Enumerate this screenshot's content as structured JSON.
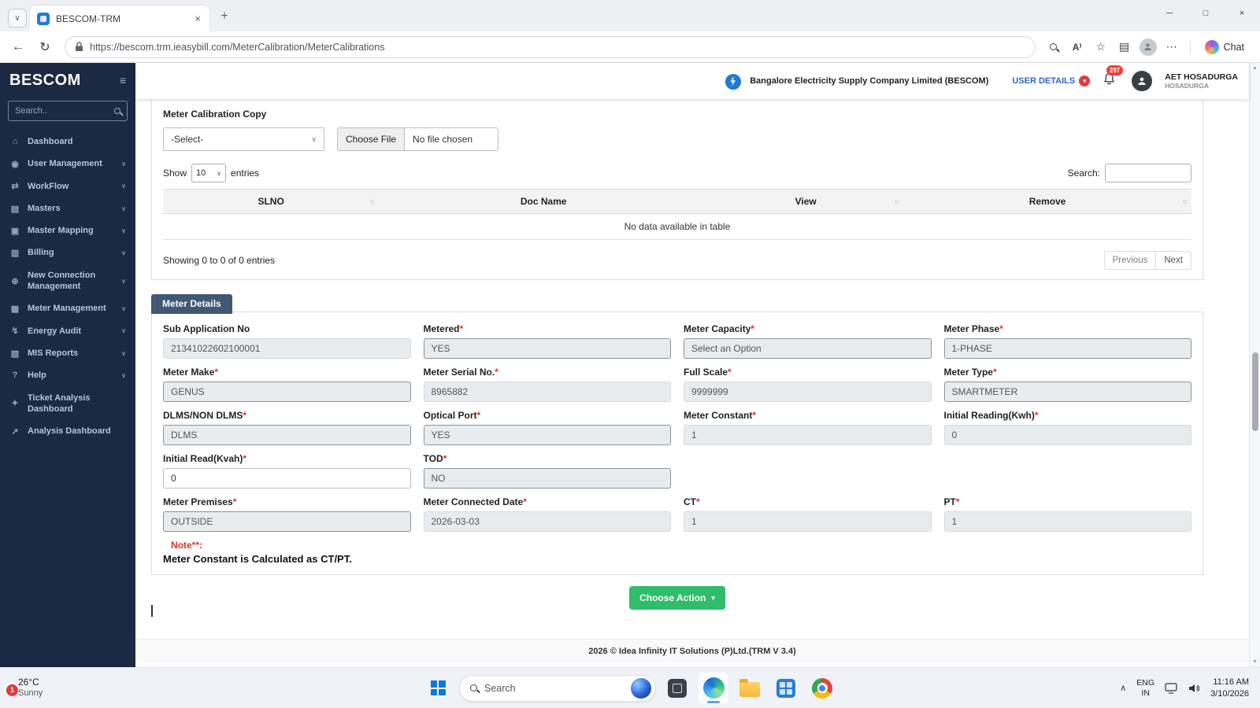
{
  "browser": {
    "tab_title": "BESCOM-TRM",
    "url": "https://bescom.trm.ieasybill.com/MeterCalibration/MeterCalibrations",
    "chat_label": "Chat"
  },
  "icons": {
    "chevron_down": "∨",
    "chevron_up": "∧",
    "caret_down": "▾",
    "hamburger": "≡",
    "back": "←",
    "refresh": "↻",
    "new_tab": "+",
    "close": "×",
    "minimize": "─",
    "maximize": "□",
    "ellipsis": "⋯",
    "star": "☆",
    "collections": "▤",
    "read_aloud": "A⁾",
    "sort": "↑↓",
    "arrow_up": "▲",
    "arrow_down": "▼"
  },
  "sidebar": {
    "brand": "BESCOM",
    "search_placeholder": "Search..",
    "items": [
      {
        "icon": "⌂",
        "label": "Dashboard",
        "chevron": false
      },
      {
        "icon": "◉",
        "label": "User Management",
        "chevron": true
      },
      {
        "icon": "⇄",
        "label": "WorkFlow",
        "chevron": true
      },
      {
        "icon": "▤",
        "label": "Masters",
        "chevron": true
      },
      {
        "icon": "▣",
        "label": "Master Mapping",
        "chevron": true
      },
      {
        "icon": "▥",
        "label": "Billing",
        "chevron": true
      },
      {
        "icon": "⊕",
        "label": "New Connection Management",
        "chevron": true
      },
      {
        "icon": "▦",
        "label": "Meter Management",
        "chevron": true
      },
      {
        "icon": "↯",
        "label": "Energy Audit",
        "chevron": true
      },
      {
        "icon": "▨",
        "label": "MIS Reports",
        "chevron": true
      },
      {
        "icon": "?",
        "label": "Help",
        "chevron": true
      },
      {
        "icon": "✦",
        "label": "Ticket Analysis Dashboard",
        "chevron": false
      },
      {
        "icon": "↗",
        "label": "Analysis Dashboard",
        "chevron": false
      }
    ]
  },
  "header": {
    "company": "Bangalore Electricity Supply Company Limited (BESCOM)",
    "user_details": "USER DETAILS",
    "badge": "297",
    "user_name": "AET HOSADURGA",
    "user_sub": "HOSADURGA"
  },
  "upload": {
    "section_label": "Meter Calibration Copy",
    "select_value": "-Select-",
    "choose_file": "Choose File",
    "no_file": "No file chosen"
  },
  "table": {
    "show": "Show",
    "page_size": "10",
    "entries": "entries",
    "search_label": "Search:",
    "headers": [
      "SLNO",
      "Doc Name",
      "View",
      "Remove"
    ],
    "empty": "No data available in table",
    "showing": "Showing 0 to 0 of 0 entries",
    "prev": "Previous",
    "next": "Next"
  },
  "details": {
    "title": "Meter Details",
    "required_mark": "*",
    "fields": [
      {
        "label": "Sub Application No",
        "required": false,
        "value": "21341022602100001",
        "kind": "readonly"
      },
      {
        "label": "Metered",
        "required": true,
        "value": "YES",
        "kind": "select"
      },
      {
        "label": "Meter Capacity",
        "required": true,
        "value": "Select an Option",
        "kind": "select"
      },
      {
        "label": "Meter Phase",
        "required": true,
        "value": "1-PHASE",
        "kind": "select"
      },
      {
        "label": "Meter Make",
        "required": true,
        "value": "GENUS",
        "kind": "select"
      },
      {
        "label": "Meter Serial No.",
        "required": true,
        "value": "8965882",
        "kind": "readonly"
      },
      {
        "label": "Full Scale",
        "required": true,
        "value": "9999999",
        "kind": "readonly"
      },
      {
        "label": "Meter Type",
        "required": true,
        "value": "SMARTMETER",
        "kind": "select"
      },
      {
        "label": "DLMS/NON DLMS",
        "required": true,
        "value": "DLMS",
        "kind": "select"
      },
      {
        "label": "Optical Port",
        "required": true,
        "value": "YES",
        "kind": "select"
      },
      {
        "label": "Meter Constant",
        "required": true,
        "value": "1",
        "kind": "readonly"
      },
      {
        "label": "Initial Reading(Kwh)",
        "required": true,
        "value": "0",
        "kind": "readonly"
      },
      {
        "label": "Initial Read(Kvah)",
        "required": true,
        "value": "0",
        "kind": "text"
      },
      {
        "label": "TOD",
        "required": true,
        "value": "NO",
        "kind": "select"
      },
      {
        "label": "Meter Premises",
        "required": true,
        "value": "OUTSIDE",
        "kind": "select"
      },
      {
        "label": "Meter Connected Date",
        "required": true,
        "value": "2026-03-03",
        "kind": "readonly"
      },
      {
        "label": "CT",
        "required": true,
        "value": "1",
        "kind": "readonly"
      },
      {
        "label": "PT",
        "required": true,
        "value": "1",
        "kind": "readonly"
      }
    ],
    "note_label": "Note**:",
    "note_text": "Meter Constant is Calculated as CT/PT.",
    "action_label": "Choose Action"
  },
  "footer": {
    "text": "2026 © Idea Infinity IT Solutions (P)Ltd.(TRM V 3.4)"
  },
  "taskbar": {
    "temp": "26°C",
    "condition": "Sunny",
    "weather_badge": "1",
    "search_placeholder": "Search",
    "lang1": "ENG",
    "lang2": "IN",
    "time": "11:16 AM",
    "date": "3/10/2026"
  }
}
